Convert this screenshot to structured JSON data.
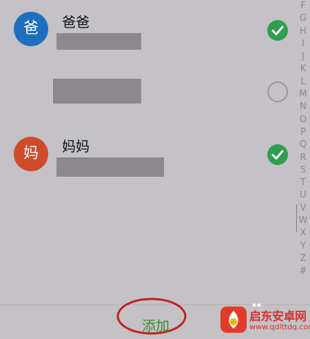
{
  "contacts": [
    {
      "avatar_char": "爸",
      "avatar_color": "#1f6fc0",
      "name": "爸爸",
      "checked": true
    },
    {
      "avatar_char": "",
      "avatar_color": "",
      "name": "",
      "checked": false
    },
    {
      "avatar_char": "妈",
      "avatar_color": "#cf4a2a",
      "name": "妈妈",
      "checked": true
    }
  ],
  "index_letters": [
    "F",
    "G",
    "H",
    "I",
    "J",
    "K",
    "L",
    "M",
    "N",
    "O",
    "P",
    "Q",
    "R",
    "S",
    "T",
    "U",
    "V",
    "W",
    "X",
    "Y",
    "Z",
    "#"
  ],
  "footer": {
    "add_label": "添加"
  },
  "watermark": {
    "title": "启东安卓网",
    "url": "www.qdlttdq.com"
  },
  "colors": {
    "background": "#c4c2c6",
    "checked": "#2f9e4f",
    "add_text": "#3a8b2f",
    "annotation_ring": "#c0201c"
  }
}
